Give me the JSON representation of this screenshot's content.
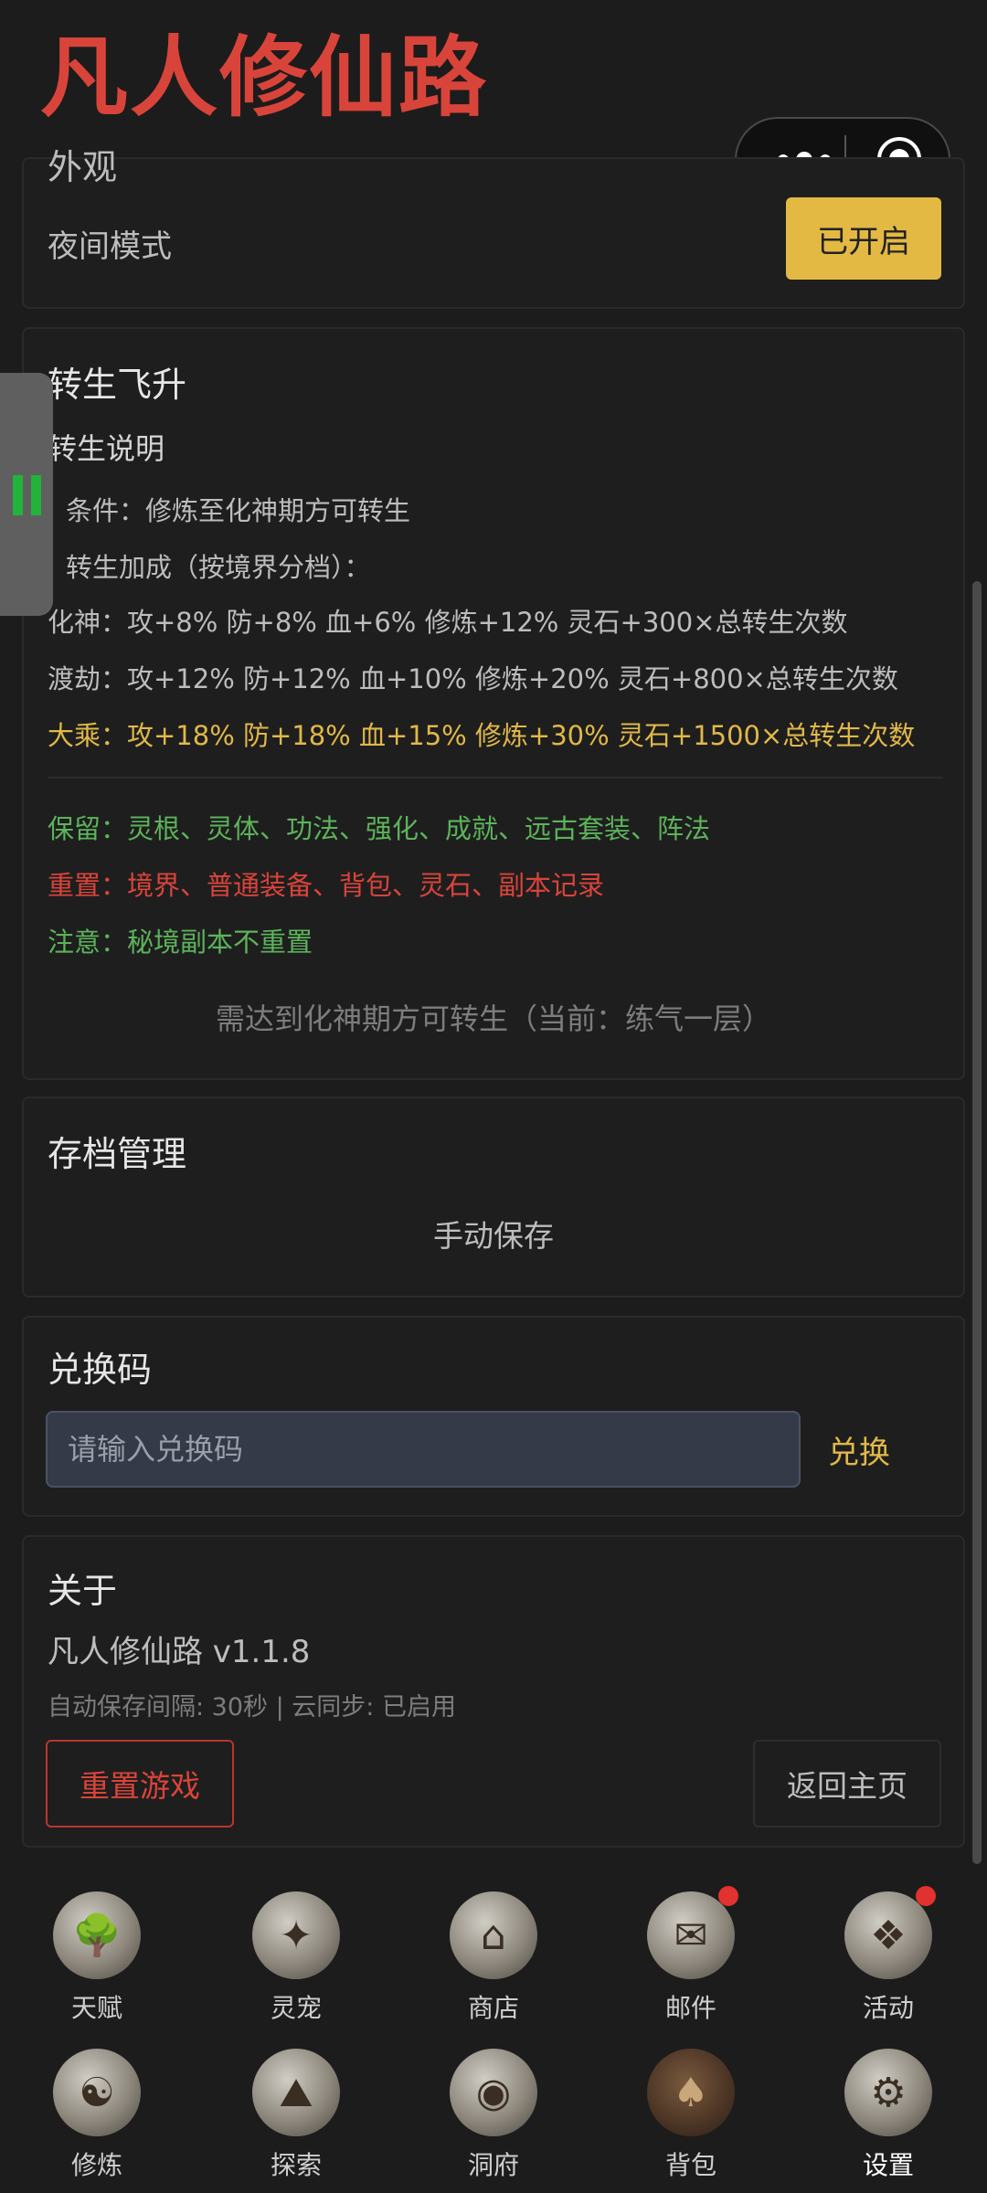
{
  "app": {
    "title": "凡人修仙路"
  },
  "appearance": {
    "title_cut": "外观",
    "night_mode_label": "夜间模式",
    "night_mode_button": "已开启"
  },
  "rebirth": {
    "title": "转生飞升",
    "subtitle": "转生说明",
    "condition": "条件：修炼至化神期方可转生",
    "bonus_title": "转生加成（按境界分档）：",
    "tiers": [
      "化神：攻+8% 防+8% 血+6% 修炼+12% 灵石+300×总转生次数",
      "渡劫：攻+12% 防+12% 血+10% 修炼+20% 灵石+800×总转生次数",
      "大乘：攻+18% 防+18% 血+15% 修炼+30% 灵石+1500×总转生次数"
    ],
    "keep": "保留：灵根、灵体、功法、强化、成就、远古套装、阵法",
    "reset": "重置：境界、普通装备、背包、灵石、副本记录",
    "note": "注意：秘境副本不重置",
    "requirement": "需达到化神期方可转生（当前：练气一层）"
  },
  "archive": {
    "title": "存档管理",
    "manual_save": "手动保存"
  },
  "redeem": {
    "title": "兑换码",
    "placeholder": "请输入兑换码",
    "button": "兑换"
  },
  "about": {
    "title": "关于",
    "version": "凡人修仙路 v1.1.8",
    "autosave": "自动保存间隔: 30秒 | 云同步: 已启用",
    "reset_button": "重置游戏",
    "home_button": "返回主页"
  },
  "nav": {
    "row1": [
      {
        "label": "天赋",
        "icon": "tree-icon",
        "badge": false
      },
      {
        "label": "灵宠",
        "icon": "spirit-pet-icon",
        "badge": false
      },
      {
        "label": "商店",
        "icon": "shop-icon",
        "badge": false
      },
      {
        "label": "邮件",
        "icon": "mail-icon",
        "badge": true
      },
      {
        "label": "活动",
        "icon": "event-icon",
        "badge": true
      }
    ],
    "row2": [
      {
        "label": "修炼",
        "icon": "meditation-icon",
        "badge": false
      },
      {
        "label": "探索",
        "icon": "explore-icon",
        "badge": false
      },
      {
        "label": "洞府",
        "icon": "cave-icon",
        "badge": false
      },
      {
        "label": "背包",
        "icon": "bag-icon",
        "badge": false
      },
      {
        "label": "设置",
        "icon": "settings-dragon-icon",
        "badge": false
      }
    ]
  },
  "colors": {
    "accent_red": "#d9443a",
    "accent_yellow": "#e3b944",
    "green": "#5cb35a",
    "background": "#1c1c1c"
  }
}
